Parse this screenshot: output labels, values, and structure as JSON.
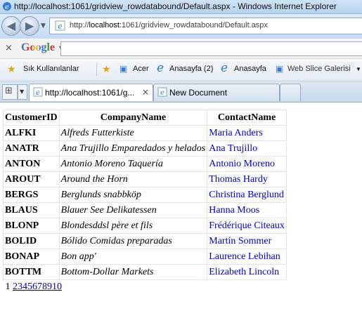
{
  "window": {
    "title": "http://localhost:1061/gridview_rowdatabound/Default.aspx - Windows Internet Explorer"
  },
  "address": {
    "url_prefix": "http://",
    "url_host": "localhost",
    "url_rest": ":1061/gridview_rowdatabound/Default.aspx"
  },
  "google": {
    "close": "×",
    "logo": "Google"
  },
  "favorites": {
    "label": "Sık Kullanılanlar",
    "items": [
      "Acer",
      "Anasayfa (2)",
      "Anasayfa",
      "Web Slice Galerisi"
    ]
  },
  "tabs": {
    "active_label": "http://localhost:1061/g...",
    "new_label": "New Document",
    "close": "×"
  },
  "grid": {
    "headers": [
      "CustomerID",
      "CompanyName",
      "ContactName"
    ],
    "rows": [
      [
        "ALFKI",
        "Alfreds Futterkiste",
        "Maria Anders"
      ],
      [
        "ANATR",
        "Ana Trujillo Emparedados y helados",
        "Ana Trujillo"
      ],
      [
        "ANTON",
        "Antonio Moreno Taquería",
        "Antonio Moreno"
      ],
      [
        "AROUT",
        "Around the Horn",
        "Thomas Hardy"
      ],
      [
        "BERGS",
        "Berglunds snabbköp",
        "Christina Berglund"
      ],
      [
        "BLAUS",
        "Blauer See Delikatessen",
        "Hanna Moos"
      ],
      [
        "BLONP",
        "Blondesddsl père et fils",
        "Frédérique Citeaux"
      ],
      [
        "BOLID",
        "Bólido Comidas preparadas",
        "Martín Sommer"
      ],
      [
        "BONAP",
        "Bon app'",
        "Laurence Lebihan"
      ],
      [
        "BOTTM",
        "Bottom-Dollar Markets",
        "Elizabeth Lincoln"
      ]
    ],
    "pager": {
      "current": "1",
      "pages": [
        "2",
        "3",
        "4",
        "5",
        "6",
        "7",
        "8",
        "9",
        "10"
      ]
    }
  }
}
